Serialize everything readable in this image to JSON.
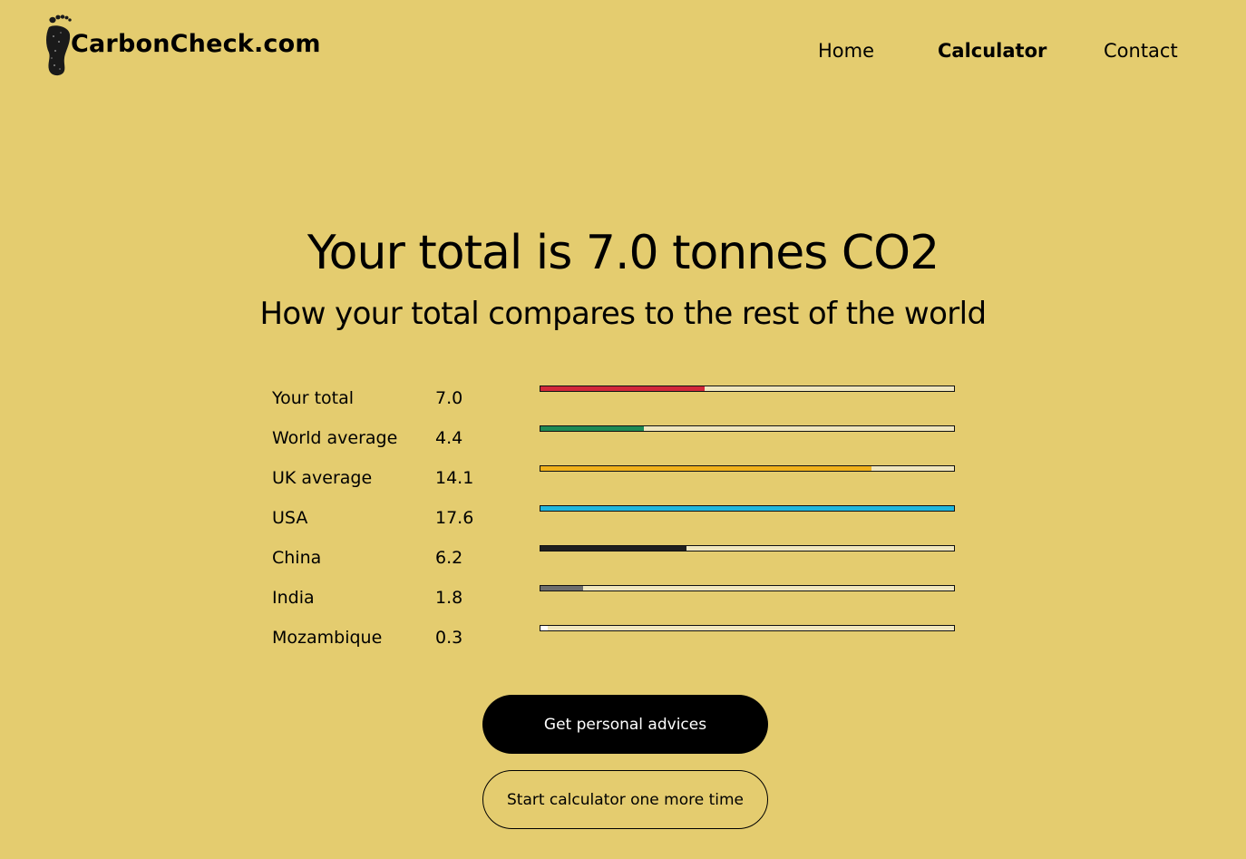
{
  "brand": {
    "name": "CarbonCheck.com",
    "icon": "footprint-icon"
  },
  "nav": {
    "home": "Home",
    "calculator": "Calculator",
    "contact": "Contact"
  },
  "result": {
    "headline": "Your total is 7.0 tonnes CO2",
    "subheadline": "How your total compares to the rest of the world"
  },
  "comparison": {
    "max": 17.6,
    "rows": [
      {
        "label": "Your total",
        "value": "7.0",
        "amount": 7.0,
        "color": "#d2283a"
      },
      {
        "label": "World average",
        "value": "4.4",
        "amount": 4.4,
        "color": "#1e8a55"
      },
      {
        "label": "UK average",
        "value": "14.1",
        "amount": 14.1,
        "color": "#f0b11b"
      },
      {
        "label": "USA",
        "value": "17.6",
        "amount": 17.6,
        "color": "#1fb7dd"
      },
      {
        "label": "China",
        "value": "6.2",
        "amount": 6.2,
        "color": "#1f1f1f"
      },
      {
        "label": "India",
        "value": "1.8",
        "amount": 1.8,
        "color": "#6d6d6d"
      },
      {
        "label": "Mozambique",
        "value": "0.3",
        "amount": 0.3,
        "color": "#ffffff"
      }
    ]
  },
  "actions": {
    "primary_label": "Get personal advices",
    "secondary_label": "Start calculator one more time"
  }
}
